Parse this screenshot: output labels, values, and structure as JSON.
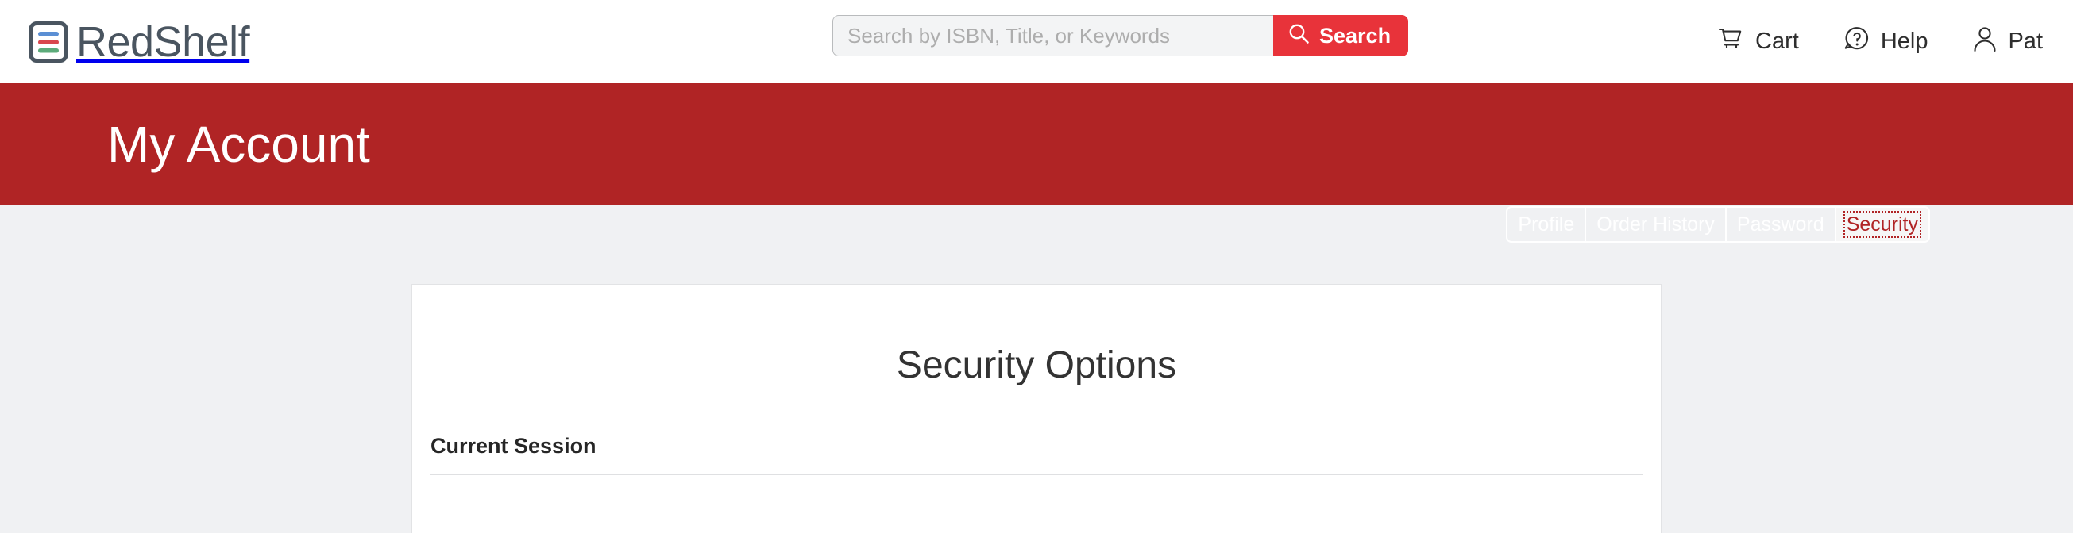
{
  "header": {
    "logo": {
      "text": "RedShelf",
      "icon": "document-lines-icon",
      "mark_color": "#4a5560",
      "line_colors": [
        "#5b8fd4",
        "#d9474e",
        "#5cab7a"
      ]
    },
    "search": {
      "placeholder": "Search by ISBN, Title, or Keywords",
      "value": "",
      "button_label": "Search",
      "button_icon": "search-icon",
      "button_color": "#e8333a"
    },
    "links": [
      {
        "label": "Cart",
        "icon": "shopping-cart-icon"
      },
      {
        "label": "Help",
        "icon": "question-bubble-icon"
      },
      {
        "label": "Pat",
        "icon": "user-icon"
      }
    ]
  },
  "banner": {
    "title": "My Account",
    "background_color": "#b02425",
    "tabs": [
      {
        "label": "Profile",
        "active": false
      },
      {
        "label": "Order History",
        "active": false
      },
      {
        "label": "Password",
        "active": false
      },
      {
        "label": "Security",
        "active": true
      }
    ]
  },
  "main": {
    "card_title": "Security Options",
    "section_label": "Current Session"
  },
  "colors": {
    "page_background": "#f0f1f3",
    "banner_red": "#b02425",
    "accent_red": "#e8333a",
    "card_background": "#ffffff",
    "card_border": "#e2e3e5"
  }
}
